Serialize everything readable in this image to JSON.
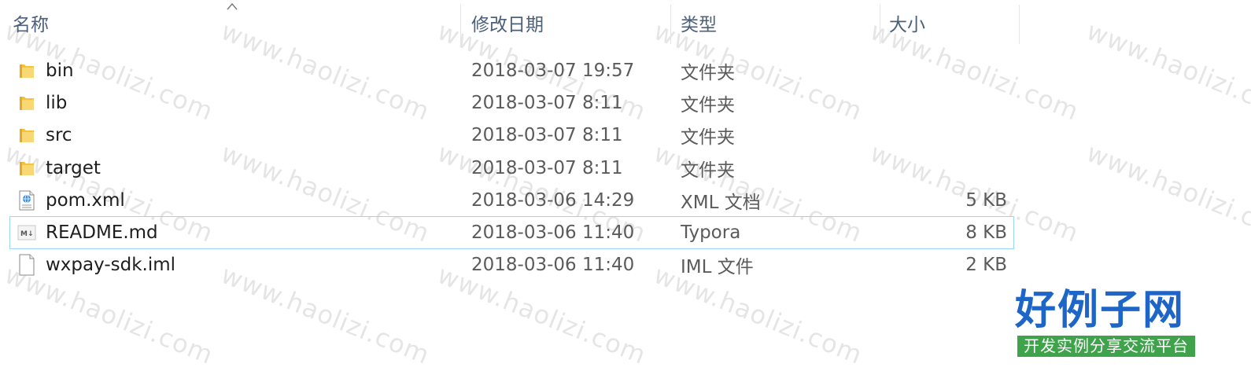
{
  "columns": {
    "name": "名称",
    "date": "修改日期",
    "type": "类型",
    "size": "大小"
  },
  "sort": {
    "column": "name",
    "direction": "ascending",
    "icon": "sort-up-icon"
  },
  "files": [
    {
      "name": "bin",
      "date": "2018-03-07 19:57",
      "type": "文件夹",
      "size": "",
      "icon": "folder-icon"
    },
    {
      "name": "lib",
      "date": "2018-03-07 8:11",
      "type": "文件夹",
      "size": "",
      "icon": "folder-icon"
    },
    {
      "name": "src",
      "date": "2018-03-07 8:11",
      "type": "文件夹",
      "size": "",
      "icon": "folder-icon"
    },
    {
      "name": "target",
      "date": "2018-03-07 8:11",
      "type": "文件夹",
      "size": "",
      "icon": "folder-icon"
    },
    {
      "name": "pom.xml",
      "date": "2018-03-06 14:29",
      "type": "XML 文档",
      "size": "5 KB",
      "icon": "xml-file-icon"
    },
    {
      "name": "README.md",
      "date": "2018-03-06 11:40",
      "type": "Typora",
      "size": "8 KB",
      "icon": "markdown-file-icon",
      "selected": true
    },
    {
      "name": "wxpay-sdk.iml",
      "date": "2018-03-06 11:40",
      "type": "IML 文件",
      "size": "2 KB",
      "icon": "blank-file-icon"
    }
  ],
  "watermark": {
    "text": "www.haolizi.com"
  },
  "brand": {
    "title": "好例子网",
    "subtitle": "开发实例分享交流平台",
    "title_color": "#1d66c7",
    "subtitle_bg": "#3ea34a"
  },
  "colors": {
    "header_text": "#4c607a",
    "selection_border": "#99d1ff",
    "folder": "#f5c33b"
  }
}
